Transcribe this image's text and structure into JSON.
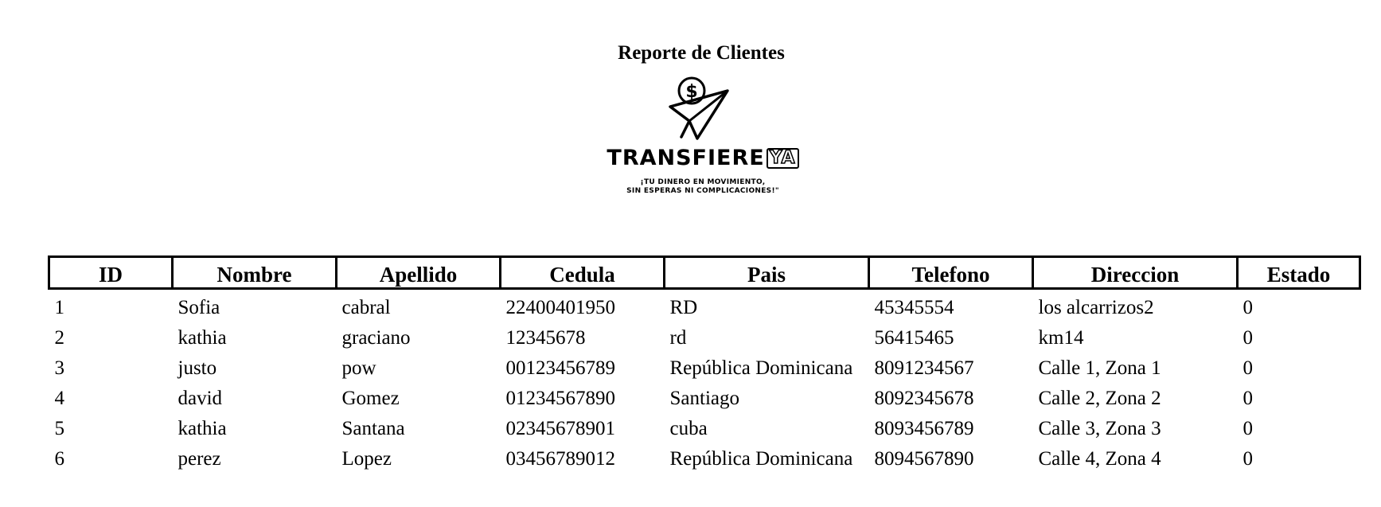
{
  "report": {
    "title": "Reporte de Clientes"
  },
  "logo": {
    "brand_main": "TRANSFIERE",
    "brand_suffix": "YA",
    "tagline_line1": "¡TU DINERO EN MOVIMIENTO,",
    "tagline_line2": "SIN ESPERAS NI COMPLICACIONES!\"",
    "icon": "dollar-coin-paper-plane-icon"
  },
  "table": {
    "headers": [
      "ID",
      "Nombre",
      "Apellido",
      "Cedula",
      "Pais",
      "Telefono",
      "Direccion",
      "Estado"
    ],
    "rows": [
      [
        "1",
        "Sofia",
        "cabral",
        "22400401950",
        "RD",
        "45345554",
        "los alcarrizos2",
        "0"
      ],
      [
        "2",
        "kathia",
        "graciano",
        "12345678",
        "rd",
        "56415465",
        "km14",
        "0"
      ],
      [
        "3",
        "justo",
        "pow",
        "00123456789",
        "República Dominicana",
        "8091234567",
        "Calle 1, Zona 1",
        "0"
      ],
      [
        "4",
        "david",
        "Gomez",
        "01234567890",
        "Santiago",
        "8092345678",
        "Calle 2, Zona 2",
        "0"
      ],
      [
        "5",
        "kathia",
        "Santana",
        "02345678901",
        "cuba",
        "8093456789",
        "Calle 3, Zona 3",
        "0"
      ],
      [
        "6",
        "perez",
        "Lopez",
        "03456789012",
        "República Dominicana",
        "8094567890",
        "Calle 4, Zona 4",
        "0"
      ]
    ]
  }
}
